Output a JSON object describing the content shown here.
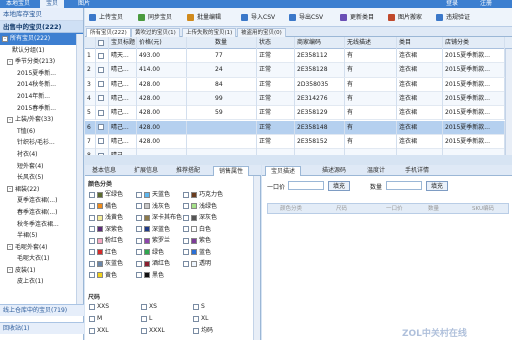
{
  "topbar": {
    "items": [
      {
        "label": "本地宝贝",
        "active": false
      },
      {
        "label": "宝贝",
        "active": true
      },
      {
        "label": "图片",
        "active": false
      },
      {
        "label": "",
        "active": false
      }
    ],
    "right": [
      "登录",
      "注册"
    ]
  },
  "sidebar": {
    "header": "本地库存宝贝",
    "section": "出售中的宝贝(222)",
    "items": [
      {
        "label": "所有宝贝(222)",
        "indent": 0,
        "toggle": "-",
        "selected": true
      },
      {
        "label": "默认分组(1)",
        "indent": 2,
        "toggle": "",
        "selected": false
      },
      {
        "label": "季节分类(213)",
        "indent": 1,
        "toggle": "-",
        "selected": false
      },
      {
        "label": "2015夏季新...",
        "indent": 3,
        "toggle": "",
        "selected": false
      },
      {
        "label": "2014秋冬新...",
        "indent": 3,
        "toggle": "",
        "selected": false
      },
      {
        "label": "2014年新...",
        "indent": 3,
        "toggle": "",
        "selected": false
      },
      {
        "label": "2015春季新...",
        "indent": 3,
        "toggle": "",
        "selected": false
      },
      {
        "label": "上装/外套(33)",
        "indent": 1,
        "toggle": "-",
        "selected": false
      },
      {
        "label": "T恤(6)",
        "indent": 3,
        "toggle": "",
        "selected": false
      },
      {
        "label": "针织衫/毛衫...",
        "indent": 3,
        "toggle": "",
        "selected": false
      },
      {
        "label": "衬衣(4)",
        "indent": 3,
        "toggle": "",
        "selected": false
      },
      {
        "label": "短外套(4)",
        "indent": 3,
        "toggle": "",
        "selected": false
      },
      {
        "label": "长风衣(5)",
        "indent": 3,
        "toggle": "",
        "selected": false
      },
      {
        "label": "裙装(22)",
        "indent": 1,
        "toggle": "-",
        "selected": false
      },
      {
        "label": "夏季连衣裙(...)",
        "indent": 3,
        "toggle": "",
        "selected": false
      },
      {
        "label": "春季连衣裙(...)",
        "indent": 3,
        "toggle": "",
        "selected": false
      },
      {
        "label": "秋冬季连衣裙...",
        "indent": 3,
        "toggle": "",
        "selected": false
      },
      {
        "label": "半裙(5)",
        "indent": 3,
        "toggle": "",
        "selected": false
      },
      {
        "label": "毛呢外套(4)",
        "indent": 1,
        "toggle": "-",
        "selected": false
      },
      {
        "label": "毛呢大衣(1)",
        "indent": 3,
        "toggle": "",
        "selected": false
      },
      {
        "label": "皮装(1)",
        "indent": 1,
        "toggle": "-",
        "selected": false
      },
      {
        "label": "皮上衣(1)",
        "indent": 3,
        "toggle": "",
        "selected": false
      }
    ],
    "footer1": "线上仓库中的宝贝(719)",
    "footer2": "回收站(1)"
  },
  "toolbar": {
    "buttons": [
      {
        "label": "上传宝贝",
        "icon": "upload-icon",
        "color": "#3b78c9"
      },
      {
        "label": "同步宝贝",
        "icon": "sync-icon",
        "color": "#4a9a3e"
      },
      {
        "label": "批量编辑",
        "icon": "batch-edit-icon",
        "color": "#d08a1c"
      },
      {
        "label": "导入CSV",
        "icon": "import-icon",
        "color": "#3b78c9"
      },
      {
        "label": "导出CSV",
        "icon": "export-icon",
        "color": "#3b78c9"
      },
      {
        "label": "更新类目",
        "icon": "update-icon",
        "color": "#6a4fb5"
      },
      {
        "label": "图片搬家",
        "icon": "image-move-icon",
        "color": "#c0492c"
      },
      {
        "label": "违规验证",
        "icon": "check-icon",
        "color": "#3b78c9"
      }
    ]
  },
  "tabs": [
    {
      "label": "所有宝贝(222)",
      "active": true
    },
    {
      "label": "黄吹过的宝贝(1)",
      "active": false
    },
    {
      "label": "上传失败的宝贝(1)",
      "active": false
    },
    {
      "label": "被盗用的宝贝(0)",
      "active": false
    }
  ],
  "grid": {
    "columns": [
      "",
      "",
      "宝贝标题",
      "价格(元)",
      "数量",
      "状态",
      "商家编码",
      "无线描述",
      "类目",
      "店铺分类"
    ],
    "rows": [
      {
        "num": "1",
        "title": "晴天...",
        "price": "493.00",
        "qty": "77",
        "status": "正常",
        "code": "2E358112",
        "wireless": "有",
        "category": "连衣裙",
        "shop": "2015夏季新款..."
      },
      {
        "num": "2",
        "title": "晴己...",
        "price": "414.00",
        "qty": "24",
        "status": "正常",
        "code": "2E358128",
        "wireless": "有",
        "category": "连衣裙",
        "shop": "2015夏季新款..."
      },
      {
        "num": "3",
        "title": "晴己...",
        "price": "428.00",
        "qty": "84",
        "status": "正常",
        "code": "2D358035",
        "wireless": "有",
        "category": "连衣裙",
        "shop": "2015夏季新款..."
      },
      {
        "num": "4",
        "title": "晴己...",
        "price": "428.00",
        "qty": "99",
        "status": "正常",
        "code": "2E314276",
        "wireless": "有",
        "category": "连衣裙",
        "shop": "2015夏季新款..."
      },
      {
        "num": "5",
        "title": "晴己...",
        "price": "428.00",
        "qty": "59",
        "status": "正常",
        "code": "2E358129",
        "wireless": "有",
        "category": "连衣裙",
        "shop": "2015夏季新款..."
      },
      {
        "num": "6",
        "title": "晴己...",
        "price": "428.00",
        "qty": "",
        "status": "正常",
        "code": "2E358148",
        "wireless": "有",
        "category": "连衣裙",
        "shop": "2015夏季新款..."
      },
      {
        "num": "7",
        "title": "晴己...",
        "price": "428.00",
        "qty": "",
        "status": "正常",
        "code": "2E358152",
        "wireless": "有",
        "category": "连衣裙",
        "shop": "2015夏季新款..."
      },
      {
        "num": "8",
        "title": "晴己...",
        "price": "",
        "qty": "",
        "status": "",
        "code": "",
        "wireless": "",
        "category": "",
        "shop": ""
      }
    ],
    "selected_index": 5
  },
  "bottom_tabs": [
    {
      "label": "基本信息",
      "active": false
    },
    {
      "label": "扩展信息",
      "active": false
    },
    {
      "label": "推荐搭配",
      "active": false
    },
    {
      "label": "销售属性",
      "active": true
    }
  ],
  "attr": {
    "color_section": "颜色分类",
    "colors": [
      {
        "label": "军绿色",
        "sw": "#5b6b2e"
      },
      {
        "label": "天蓝色",
        "sw": "#5fb7ee"
      },
      {
        "label": "巧克力色",
        "sw": "#6b3d1e"
      },
      {
        "label": "橘色",
        "sw": "#f08c1c"
      },
      {
        "label": "浅灰色",
        "sw": "#c8c8c8"
      },
      {
        "label": "浅绿色",
        "sw": "#a6e28a"
      },
      {
        "label": "浅黄色",
        "sw": "#f5ee9c"
      },
      {
        "label": "深卡其布色",
        "sw": "#8c7a4b"
      },
      {
        "label": "深灰色",
        "sw": "#555555"
      },
      {
        "label": "深紫色",
        "sw": "#5c2a7a"
      },
      {
        "label": "深蓝色",
        "sw": "#1e3a8a"
      },
      {
        "label": "白色",
        "sw": "#ffffff"
      },
      {
        "label": "粉红色",
        "sw": "#f7a8c4"
      },
      {
        "label": "紫罗兰",
        "sw": "#8e44ad"
      },
      {
        "label": "紫色",
        "sw": "#7d3c98"
      },
      {
        "label": "红色",
        "sw": "#d62a2a"
      },
      {
        "label": "绿色",
        "sw": "#2fa84f"
      },
      {
        "label": "蓝色",
        "sw": "#2a6fd6"
      },
      {
        "label": "灰蓝色",
        "sw": "#6a86a8"
      },
      {
        "label": "酒红色",
        "sw": "#8a1f2f"
      },
      {
        "label": "透明",
        "sw": "#eef6ff"
      },
      {
        "label": "黄色",
        "sw": "#f2d21d"
      },
      {
        "label": "黑色",
        "sw": "#111111"
      }
    ],
    "size_section": "尺码",
    "sizes": [
      "XXS",
      "XS",
      "S",
      "M",
      "L",
      "XL",
      "XXL",
      "XXXL",
      "均码"
    ]
  },
  "right_tabs": [
    {
      "label": "宝贝描述",
      "active": true
    },
    {
      "label": "描述源码",
      "active": false
    },
    {
      "label": "温度计",
      "active": false
    },
    {
      "label": "手机详情",
      "active": false
    }
  ],
  "right_panel": {
    "price_label": "一口价",
    "qty_label": "数量",
    "fill1": "填充",
    "fill2": "填充",
    "headers": [
      "颜色分类",
      "尺码",
      "一口价",
      "数量",
      "SKU编码"
    ]
  },
  "watermark": "ZOL中关村在线"
}
